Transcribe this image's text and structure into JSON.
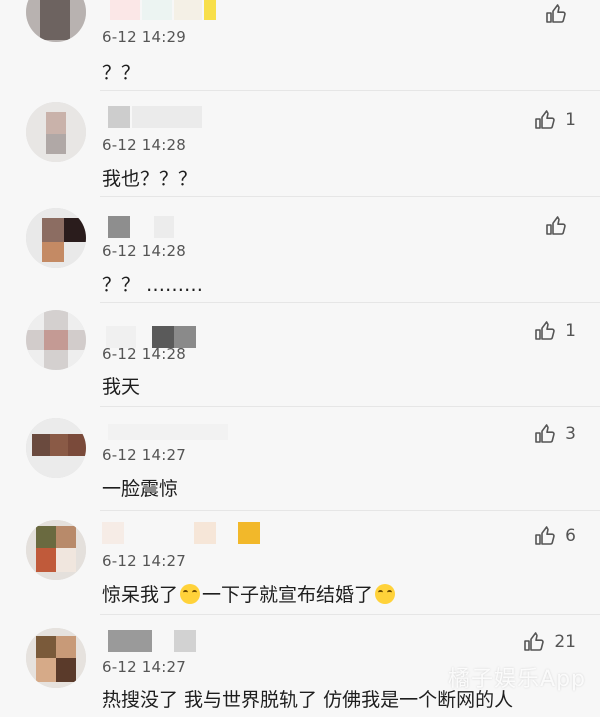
{
  "comments": [
    {
      "time": "6-12 14:29",
      "text": "？？",
      "likes": ""
    },
    {
      "time": "6-12 14:28",
      "text": "我也？？？",
      "likes": "1"
    },
    {
      "time": "6-12 14:28",
      "text": "？？ ………",
      "likes": ""
    },
    {
      "time": "6-12 14:28",
      "text": "我天",
      "likes": "1"
    },
    {
      "time": "6-12 14:27",
      "text": "一脸震惊",
      "likes": "3"
    },
    {
      "time": "6-12 14:27",
      "text_a": "惊呆我了",
      "text_b": "一下子就宣布结婚了",
      "likes": "6"
    },
    {
      "time": "6-12 14:27",
      "text": "热搜没了 我与世界脱轨了 仿佛我是一个断网的人",
      "likes": "21"
    }
  ],
  "watermark": "橘子娱乐App",
  "icons": {
    "like": "thumbs-up-icon",
    "emoji": "crying-laughing-emoji-icon"
  }
}
